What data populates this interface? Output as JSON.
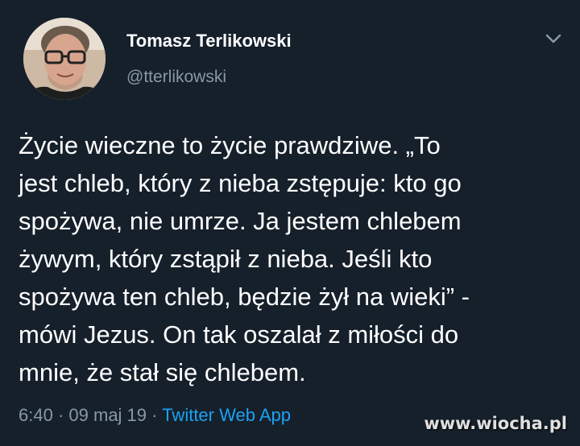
{
  "author": {
    "name": "Tomasz Terlikowski",
    "handle": "@tterlikowski",
    "avatar_icon": "profile-photo"
  },
  "tweet": {
    "text": "Życie wieczne to życie prawdziwe. „To\njest chleb, który z nieba zstępuje: kto go\nspożywa, nie umrze. Ja jestem chlebem\nżywym, który zstąpił z nieba. Jeśli kto\nspożywa ten chleb, będzie żył na wieki” -\nmówi Jezus. On tak oszalał z miłości do\nmnie, że stał się chlebem.",
    "time": "6:40",
    "date": "09 maj 19",
    "separator": "·",
    "source": "Twitter Web App"
  },
  "menu": {
    "icon": "chevron-down-icon"
  },
  "watermark": "www.wiocha.pl",
  "colors": {
    "background": "#15202b",
    "text": "#ffffff",
    "secondary": "#8899a6",
    "link": "#1da1f2"
  }
}
